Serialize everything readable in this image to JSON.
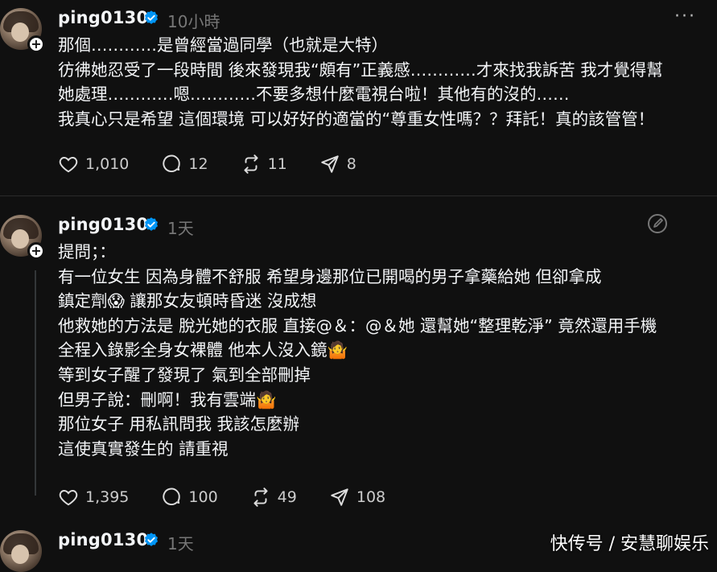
{
  "posts": [
    {
      "username": "ping0130",
      "time": "10小時",
      "more": "···",
      "text": "那個…………是曾經當過同學（也就是大特）\n彷彿她忍受了一段時間 後來發現我“頗有”正義感…………才來找我訴苦 我才覺得幫\n她處理…………嗯…………不要多想什麼電視台啦！其他有的沒的……\n我真心只是希望 這個環境 可以好好的適當的“尊重女性嗎？？拜託！真的該管管！",
      "likes": "1,010",
      "comments": "12",
      "reposts": "11",
      "shares": "8"
    },
    {
      "username": "ping0130",
      "time": "1天",
      "text": "提問；：\n有一位女生 因為身體不舒服 希望身邊那位已開喝的男子拿藥給她 但卻拿成\n鎮定劑😱 讓那女友頓時昏迷 沒成想\n他救她的方法是 脫光她的衣服 直接@＆：@＆她 還幫她“整理乾淨” 竟然還用手機\n全程入錄影全身女裸體 他本人沒入鏡🤷\n等到女子醒了發現了 氣到全部刪掉\n但男子說：刪啊！我有雲端🤷\n那位女子 用私訊問我 我該怎麼辦\n這使真實發生的 請重視",
      "likes": "1,395",
      "comments": "100",
      "reposts": "49",
      "shares": "108"
    },
    {
      "username": "ping0130",
      "time": "1天"
    }
  ],
  "watermark": "快传号 / 安慧聊娱乐",
  "colors": {
    "background": "#101010",
    "verified": "#0095f6",
    "muted": "#777777"
  },
  "icons": [
    "heart-icon",
    "comment-icon",
    "repost-icon",
    "share-icon",
    "verified-icon",
    "edit-icon"
  ]
}
